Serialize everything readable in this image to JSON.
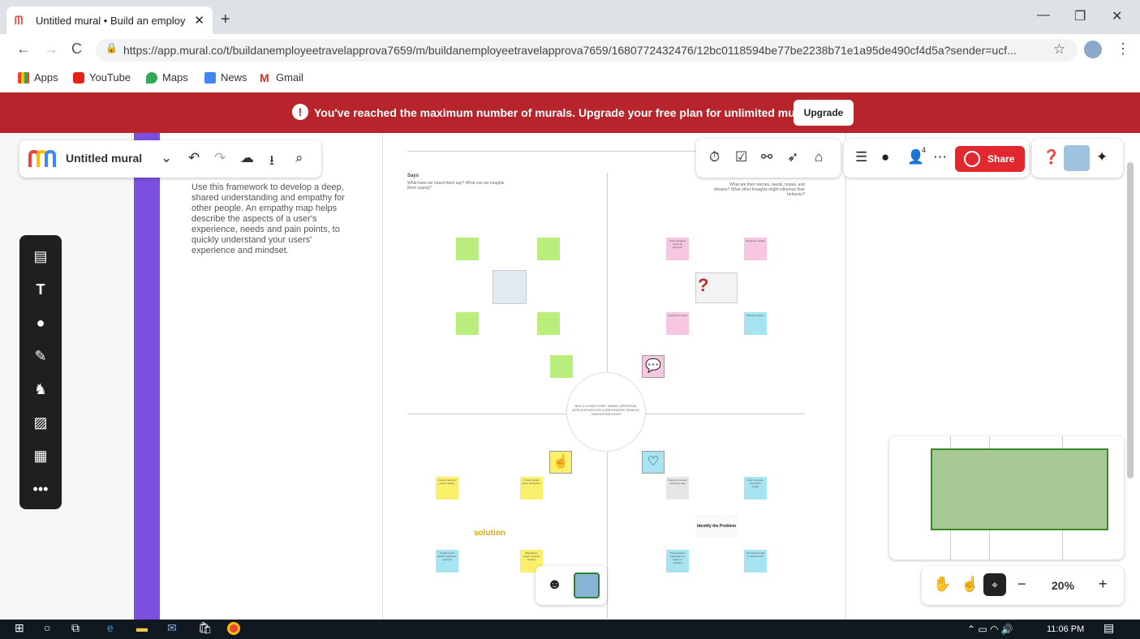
{
  "browser": {
    "tab_title": "Untitled mural • Build an employ",
    "tab_close": "✕",
    "new_tab": "+",
    "url": "https://app.mural.co/t/buildanemployeetravelapprova7659/m/buildanemployeetravelapprova7659/1680772432476/12bc0118594be77be2238b71e1a95de490cf4d5a?sender=ucf...",
    "bookmarks": [
      "Apps",
      "YouTube",
      "Maps",
      "News",
      "Gmail"
    ],
    "window_controls": [
      "—",
      "❐",
      "✕"
    ],
    "nav": [
      "←",
      "→",
      "C"
    ]
  },
  "banner": {
    "icon": "!",
    "message": "You've reached the maximum number of murals. Upgrade your free plan for unlimited murals.",
    "button": "Upgrade"
  },
  "mural": {
    "title": "Untitled mural",
    "dropdown": "⌄",
    "description": "Use this framework to develop a deep, shared understanding and empathy for other people. An empathy map helps describe the aspects of a user's experience, needs and pain points, to quickly understand your users' experience and mindset.",
    "says_title": "Says",
    "says_sub": "What have we heard them say? What can we imagine them saying?",
    "feels_sub": "What are their worries, needs, hopes, and dreams? What other thoughts might influence their behavior?",
    "center_text": "BUILD A EMPLOYEE TRAVEL APPROVAL APPLICATION FOR CORPORATES TEAM ID: NM2023TMID14924",
    "stickies": {
      "g1": "",
      "g2": "",
      "g3": "",
      "g4": "",
      "p1": "Travel Request Approval Required",
      "p2": "Employee details",
      "p3": "Application issues",
      "b1": "Missing problem",
      "y1": "Custom data and project setting",
      "y2": "Project details about destination",
      "gr1": "Selection reviews and Save data",
      "b2": "Give employee destination details",
      "b3": "Update travel details application approval",
      "y3": "Maintaining project meeting location",
      "b4": "Travel request application to collect to manager",
      "b5": "Sort project limits to detail travel"
    },
    "solution_label": "solution",
    "identify_label": "Identify the Problem"
  },
  "toolbar": {
    "share": "Share",
    "people_count": "4",
    "zoom": "20%",
    "zoom_minus": "−",
    "zoom_plus": "+"
  },
  "taskbar": {
    "time": "11:06 PM"
  },
  "colors": {
    "banner": "#b8242b",
    "accent_purple": "#7b4fe0",
    "share": "#e0282e",
    "sticky_green": "#b9ee7c",
    "sticky_pink": "#f7c6e0",
    "sticky_blue": "#a6e4f2",
    "sticky_yellow": "#faf06c"
  },
  "icons": [
    "undo-icon",
    "redo-icon",
    "cloud-icon",
    "download-icon",
    "search-icon",
    "timer-icon",
    "checkbox-icon",
    "binoculars-icon",
    "cursor-icon",
    "toolbox-icon",
    "outline-icon",
    "chat-icon",
    "people-icon",
    "more-icon",
    "help-icon",
    "sparkle-icon",
    "hand-icon",
    "pointer-hand-icon",
    "map-icon"
  ]
}
